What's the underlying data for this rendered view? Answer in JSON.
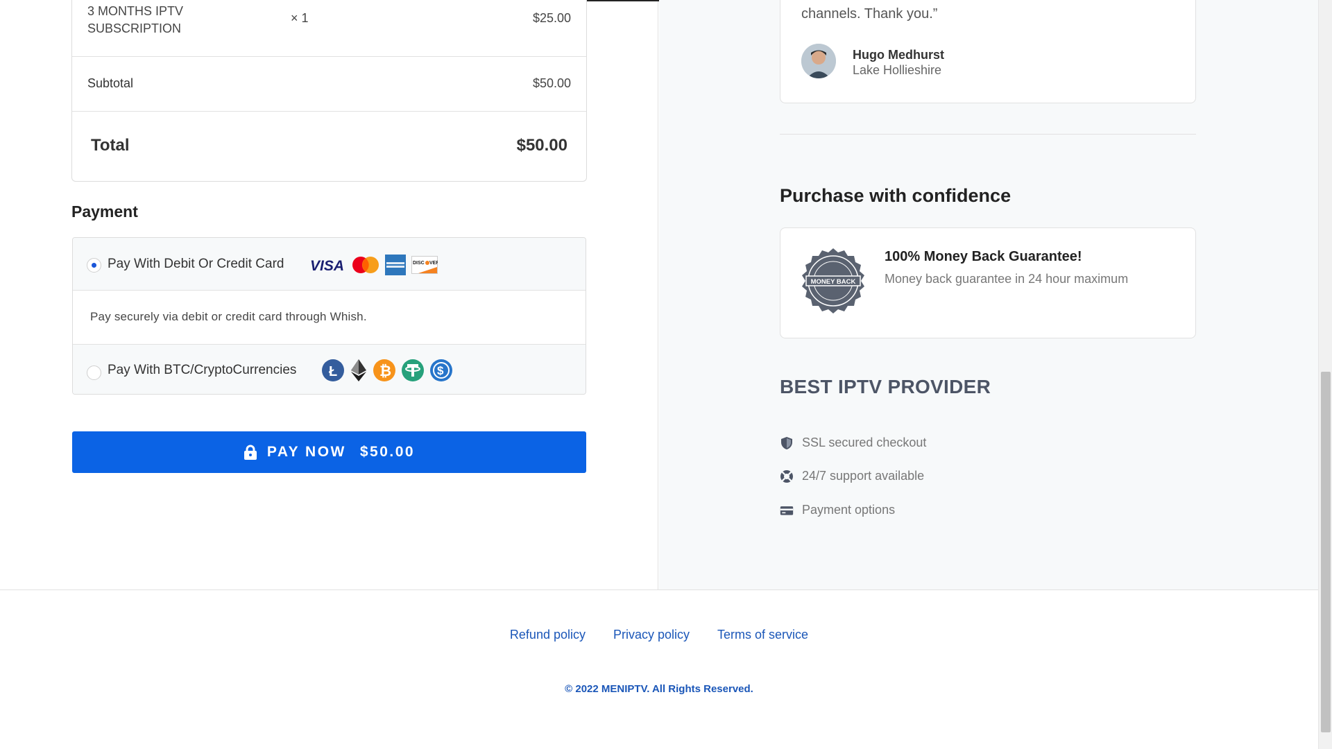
{
  "order": {
    "item_name": "3 MONTHS IPTV SUBSCRIPTION",
    "item_qty": "× 1",
    "item_price": "$25.00",
    "subtotal_label": "Subtotal",
    "subtotal_value": "$50.00",
    "total_label": "Total",
    "total_value": "$50.00"
  },
  "payment": {
    "title": "Payment",
    "option_card_label": "Pay With Debit Or Credit Card",
    "option_card_selected": true,
    "option_card_description": "Pay securely via debit or credit card through Whish.",
    "option_crypto_label": "Pay With BTC/CryptoCurrencies",
    "card_icons": [
      "visa-icon",
      "mastercard-icon",
      "amex-icon",
      "discover-icon"
    ],
    "crypto_icons": [
      "litecoin-icon",
      "ethereum-icon",
      "bitcoin-icon",
      "tether-icon",
      "usdc-icon"
    ],
    "pay_button_label": "PAY NOW",
    "pay_button_amount": "$50.00",
    "accent_color": "#0b63e5"
  },
  "review": {
    "text": "channels. Thank you.”",
    "name": "Hugo Medhurst",
    "location": "Lake Hollieshire"
  },
  "confidence": {
    "title": "Purchase with confidence",
    "badge_text": "MONEY BACK",
    "guarantee_title": "100% Money Back Guarantee!",
    "guarantee_subtitle": "Money back guarantee in 24 hour maximum"
  },
  "provider": {
    "title": "BEST IPTV PROVIDER",
    "features": [
      {
        "icon": "shield-icon",
        "label": "SSL secured checkout"
      },
      {
        "icon": "lifebuoy-icon",
        "label": "24/7 support available"
      },
      {
        "icon": "credit-card-icon",
        "label": "Payment options"
      }
    ]
  },
  "footer": {
    "links": [
      "Refund policy",
      "Privacy policy",
      "Terms of service"
    ],
    "copyright": "© 2022 MENIPTV. All Rights Reserved."
  }
}
